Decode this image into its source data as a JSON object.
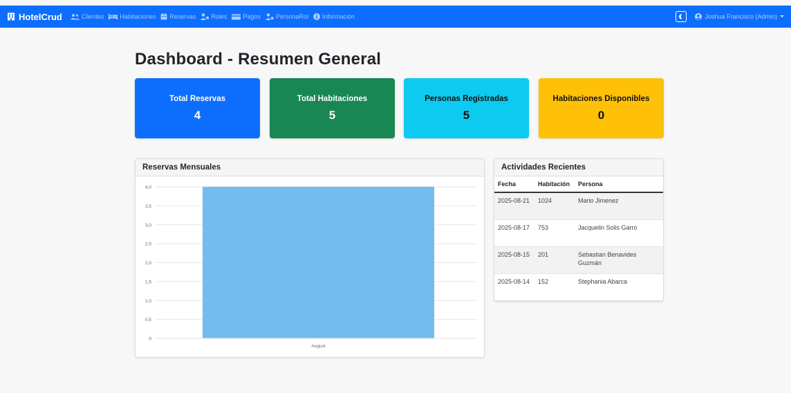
{
  "navbar": {
    "brand": "HotelCrud",
    "items": [
      {
        "label": "Clientes",
        "icon": "users-icon"
      },
      {
        "label": "Habitaciones",
        "icon": "bed-icon"
      },
      {
        "label": "Reservas",
        "icon": "calendar-icon"
      },
      {
        "label": "Roles",
        "icon": "user-tag-icon"
      },
      {
        "label": "Pagos",
        "icon": "money-icon"
      },
      {
        "label": "PersonaRol",
        "icon": "user-cog-icon"
      },
      {
        "label": "Información",
        "icon": "info-circle-icon"
      }
    ],
    "user": "Joshua Francisco (Admin)"
  },
  "page": {
    "title": "Dashboard - Resumen General"
  },
  "cards": [
    {
      "label": "Total Reservas",
      "value": "4",
      "color": "#0d6efd"
    },
    {
      "label": "Total Habitaciones",
      "value": "5",
      "color": "#198754"
    },
    {
      "label": "Personas Registradas",
      "value": "5",
      "color": "#0dcaf0"
    },
    {
      "label": "Habitaciones Disponibles",
      "value": "0",
      "color": "#ffc107"
    }
  ],
  "chart_panel": {
    "title": "Reservas Mensuales"
  },
  "chart_data": {
    "type": "bar",
    "categories": [
      "August"
    ],
    "values": [
      4
    ],
    "ylim": [
      0,
      4
    ],
    "yticks": [
      "0",
      "0,5",
      "1,0",
      "1,5",
      "2,0",
      "2,5",
      "3,0",
      "3,5",
      "4,0"
    ],
    "grid": true,
    "bar_color": "#73bcef"
  },
  "activities": {
    "title": "Actividades Recientes",
    "headers": [
      "Fecha",
      "Habitación",
      "Persona"
    ],
    "rows": [
      {
        "date": "2025-08-21",
        "room": "1024",
        "person": "Mario Jimenez"
      },
      {
        "date": "2025-08-17",
        "room": "753",
        "person": "Jacquelin Solis Garro"
      },
      {
        "date": "2025-08-15",
        "room": "201",
        "person": "Sebastian Benavides Guzmán"
      },
      {
        "date": "2025-08-14",
        "room": "152",
        "person": "Stephania Abarca"
      }
    ]
  }
}
